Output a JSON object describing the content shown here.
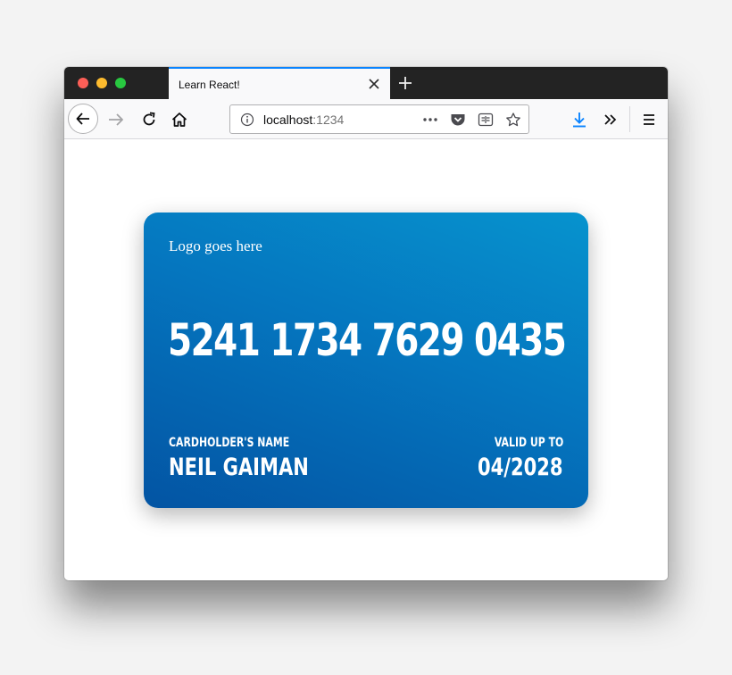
{
  "browser": {
    "tab_title": "Learn React!",
    "url_host": "localhost",
    "url_port": ":1234",
    "accent_color": "#0a84ff",
    "toolbar_icons": [
      "back-icon",
      "forward-icon",
      "reload-icon",
      "home-icon",
      "info-icon",
      "more-icon",
      "pocket-icon",
      "reader-view-icon",
      "bookmark-star-icon",
      "download-icon",
      "overflow-icon",
      "hamburger-menu-icon"
    ]
  },
  "card": {
    "logo_text": "Logo goes here",
    "number": "5241 1734 7629 0435",
    "holder_label": "CARDHOLDER'S NAME",
    "holder_name": "NEIL GAIMAN",
    "valid_label": "VALID UP TO",
    "valid_date": "04/2028",
    "gradient_colors": [
      "#0693ce",
      "#0354a3"
    ]
  }
}
